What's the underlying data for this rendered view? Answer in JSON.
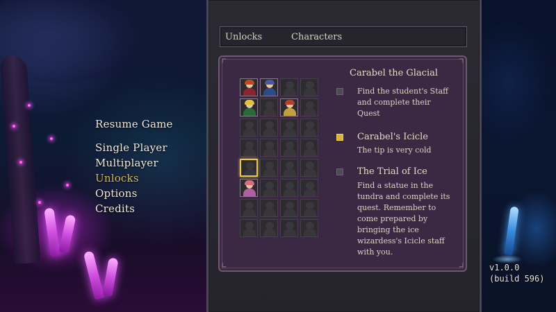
{
  "main_menu": {
    "items": [
      {
        "label": "Resume Game",
        "active": false
      },
      {
        "label": "Single Player",
        "active": false
      },
      {
        "label": "Multiplayer",
        "active": false
      },
      {
        "label": "Unlocks",
        "active": true
      },
      {
        "label": "Options",
        "active": false
      },
      {
        "label": "Credits",
        "active": false
      }
    ]
  },
  "breadcrumb": {
    "section": "Unlocks",
    "subsection": "Characters"
  },
  "character_grid": {
    "columns": 4,
    "rows": 8,
    "selected_index": 16,
    "cells": [
      {
        "state": "unlocked",
        "hair": "#c04a20",
        "body": "#8a2430"
      },
      {
        "state": "unlocked",
        "hair": "#4a5aa0",
        "body": "#2e4a8a"
      },
      {
        "state": "locked"
      },
      {
        "state": "locked"
      },
      {
        "state": "unlocked",
        "hair": "#e0c040",
        "body": "#2a6a3a"
      },
      {
        "state": "locked"
      },
      {
        "state": "unlocked",
        "hair": "#b04030",
        "body": "#c0a040"
      },
      {
        "state": "locked"
      },
      {
        "state": "locked"
      },
      {
        "state": "locked"
      },
      {
        "state": "locked"
      },
      {
        "state": "locked"
      },
      {
        "state": "locked"
      },
      {
        "state": "locked"
      },
      {
        "state": "locked"
      },
      {
        "state": "locked"
      },
      {
        "state": "locked"
      },
      {
        "state": "locked"
      },
      {
        "state": "locked"
      },
      {
        "state": "locked"
      },
      {
        "state": "unlocked",
        "hair": "#d07080",
        "body": "#b060a0"
      },
      {
        "state": "locked"
      },
      {
        "state": "locked"
      },
      {
        "state": "locked"
      },
      {
        "state": "locked"
      },
      {
        "state": "locked"
      },
      {
        "state": "locked"
      },
      {
        "state": "locked"
      },
      {
        "state": "locked"
      },
      {
        "state": "locked"
      },
      {
        "state": "locked"
      },
      {
        "state": "locked"
      }
    ]
  },
  "character_detail": {
    "name": "Carabel the Glacial",
    "unlocks": [
      {
        "title": "",
        "description_lines": [
          "Find the student's Staff",
          "and complete their",
          "Quest"
        ],
        "completed": false
      },
      {
        "title": "Carabel's Icicle",
        "description_lines": [
          "The tip is very cold"
        ],
        "completed": true
      },
      {
        "title": "The Trial of Ice",
        "description_lines": [
          "Find a statue in the",
          "tundra and complete its",
          "quest. Remember to",
          "come prepared by",
          "bringing the ice",
          "wizardess's Icicle staff",
          "with you."
        ],
        "completed": false
      }
    ]
  },
  "version": {
    "line1": "v1.0.0",
    "line2": "(build 596)"
  },
  "colors": {
    "accent_gold": "#d9b85a",
    "menu_text": "#f2ead8",
    "panel_purple": "#3b2944"
  }
}
